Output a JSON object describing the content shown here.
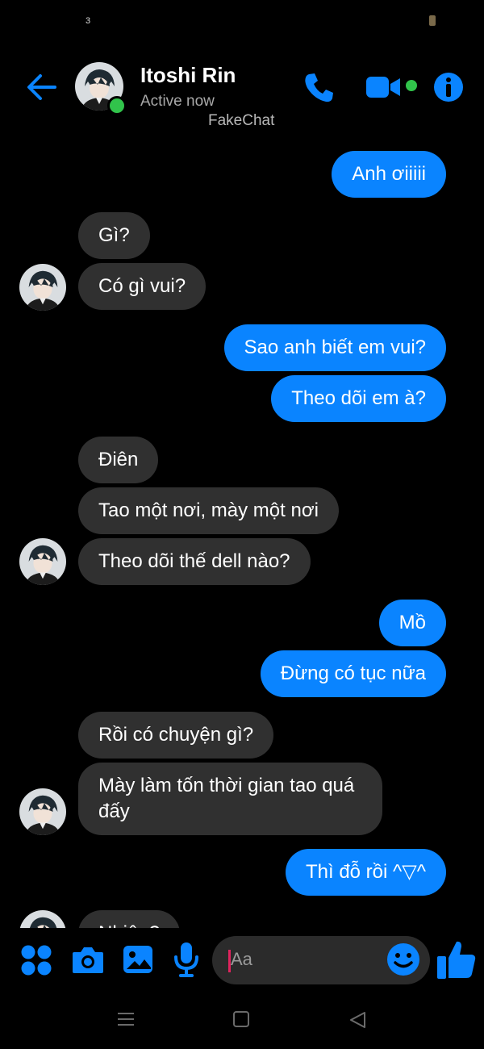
{
  "status_bar": {
    "notification_count": "3"
  },
  "header": {
    "name": "Itoshi Rin",
    "status": "Active now",
    "watermark": "FakeChat",
    "icons": [
      "back-arrow-icon",
      "phone-icon",
      "video-camera-icon",
      "info-icon"
    ]
  },
  "messages": [
    {
      "from": "me",
      "text": "Anh ơiiiii"
    },
    {
      "from": "them",
      "text": "Gì?"
    },
    {
      "from": "them",
      "text": "Có gì vui?"
    },
    {
      "from": "me",
      "text": "Sao anh biết em vui?"
    },
    {
      "from": "me",
      "text": "Theo dõi em à?"
    },
    {
      "from": "them",
      "text": "Điên"
    },
    {
      "from": "them",
      "text": "Tao một nơi, mày một nơi"
    },
    {
      "from": "them",
      "text": "Theo dõi thế dell nào?"
    },
    {
      "from": "me",
      "text": "Mồ"
    },
    {
      "from": "me",
      "text": "Đừng có tục nữa"
    },
    {
      "from": "them",
      "text": "Rồi có chuyện gì?"
    },
    {
      "from": "them",
      "text": "Mày làm tốn thời gian tao quá\nđấy"
    },
    {
      "from": "me",
      "text": "Thì đỗ rồi ^▽^"
    },
    {
      "from": "them",
      "text": "Nhiêu?"
    }
  ],
  "composer": {
    "placeholder": "Aa",
    "icons": [
      "apps-icon",
      "camera-icon",
      "gallery-icon",
      "microphone-icon",
      "emoji-icon",
      "thumbs-up-icon"
    ]
  },
  "colors": {
    "accent": "#0a84ff",
    "received_bubble": "#303030",
    "online": "#31c34b",
    "background": "#000000"
  }
}
